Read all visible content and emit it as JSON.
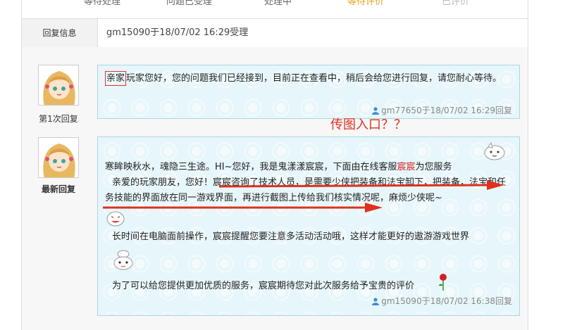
{
  "tabs": [
    {
      "label": "等待处理",
      "state": "normal"
    },
    {
      "label": "问题已受理",
      "state": "normal"
    },
    {
      "label": "处理中",
      "state": "normal"
    },
    {
      "label": "等待评价",
      "state": "active"
    },
    {
      "label": "已评价",
      "state": "disabled"
    }
  ],
  "reply_info": {
    "label": "回复信息",
    "value": "gm15090于18/07/02 16:29受理"
  },
  "replies": [
    {
      "caption": "第1次回复",
      "highlight": "亲家",
      "text_rest": "玩家您好，您的问题我们已经接到，目前正在查看中，稍后会给您进行回复，请您耐心等待。",
      "meta": "gm77650于18/07/02 16:29回复"
    },
    {
      "caption": "最新回复",
      "line1_a": "寒眸映秋水，魂隐三生途。HI~您好，我是鬼漾漾宸宸，下面由在线客服",
      "line1_name": "宸宸",
      "line1_b": "为您服务",
      "line2": "亲爱的玩家朋友，您好！宸宸咨询了技术人员，是需要少侠把装备和法宝卸下，把装备，法宝和任务技能的界面放在同一游戏界面，再进行截图上传给我们核实情况呢，麻烦少侠呢~",
      "line3": "长时间在电脑面前操作，宸宸提醒您要注意多活动活动哦，这样才能更好的遨游游戏世界",
      "line4": "为了可以给您提供更加优质的服务，宸宸期待您对此次服务给予宝贵的评价",
      "meta": "gm15090于18/07/02 16:38回复"
    }
  ],
  "annotation": "传图入口？？",
  "colors": {
    "accent_active_tab": "#e8a018",
    "annotation_red": "#e0301e",
    "bubble_bg": "#e7f6fb",
    "bubble_border": "#a9d6e5"
  }
}
